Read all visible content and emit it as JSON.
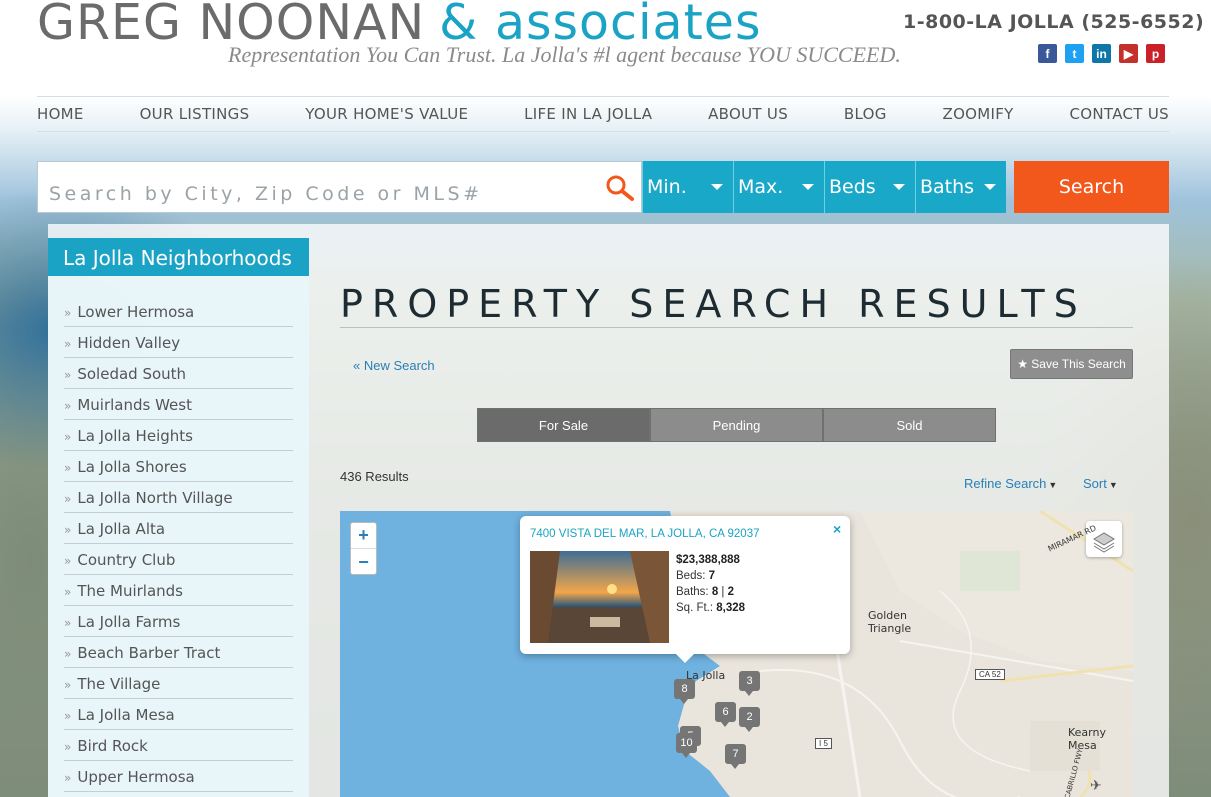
{
  "header": {
    "logo_main": "GREG NOONAN",
    "logo_amp": "& associates",
    "tagline": "Representation You Can Trust. La Jolla's #l agent because YOU SUCCEED.",
    "phone": "1-800-LA JOLLA (525-6552)",
    "social": [
      {
        "icon": "facebook-icon",
        "glyph": "f",
        "color": "#3b5998"
      },
      {
        "icon": "twitter-icon",
        "glyph": "t",
        "color": "#1da1f2"
      },
      {
        "icon": "linkedin-icon",
        "glyph": "in",
        "color": "#0e76a8"
      },
      {
        "icon": "youtube-icon",
        "glyph": "▶",
        "color": "#c4302b"
      },
      {
        "icon": "pinterest-icon",
        "glyph": "p",
        "color": "#cb2027"
      }
    ]
  },
  "nav": [
    "HOME",
    "OUR LISTINGS",
    "YOUR HOME'S VALUE",
    "LIFE IN LA JOLLA",
    "ABOUT US",
    "BLOG",
    "ZOOMIFY",
    "CONTACT US"
  ],
  "search": {
    "placeholder": "Search by City, Zip Code or MLS#",
    "dropdowns": [
      "Min.",
      "Max.",
      "Beds",
      "Baths"
    ],
    "button": "Search"
  },
  "sidebar": {
    "title": "La Jolla Neighborhoods",
    "items": [
      "Lower Hermosa",
      "Hidden Valley",
      "Soledad South",
      "Muirlands West",
      "La Jolla Heights",
      "La Jolla Shores",
      "La Jolla North Village",
      "La Jolla Alta",
      "Country Club",
      "The Muirlands",
      "La Jolla Farms",
      "Beach Barber Tract",
      "The Village",
      "La Jolla Mesa",
      "Bird Rock",
      "Upper Hermosa"
    ]
  },
  "main": {
    "title": "PROPERTY SEARCH RESULTS",
    "new_search": "« New Search",
    "save_search": "★ Save This Search",
    "tabs": [
      "For Sale",
      "Pending",
      "Sold"
    ],
    "results_count": "436 Results",
    "refine": "Refine Search",
    "sort": "Sort"
  },
  "map": {
    "zoom_in": "+",
    "zoom_out": "−",
    "popup": {
      "address": "7400 VISTA DEL MAR, LA JOLLA, CA 92037",
      "close": "×",
      "price": "$23,388,888",
      "beds_label": "Beds:",
      "beds": "7",
      "baths_label": "Baths:",
      "baths_full": "8",
      "baths_sep": "|",
      "baths_half": "2",
      "sqft_label": "Sq. Ft.:",
      "sqft": "8,328"
    },
    "labels": {
      "la_jolla": "La Jolla",
      "golden_triangle": "Golden\nTriangle",
      "kearny_mesa": "Kearny\nMesa",
      "miramar": "MIRAMAR RD",
      "ca52": "CA 52",
      "i5": "I 5",
      "cabrillo": "CABRILLO FWY"
    },
    "markers": [
      "8",
      "3",
      "6",
      "2",
      "5",
      "10",
      "7"
    ]
  }
}
